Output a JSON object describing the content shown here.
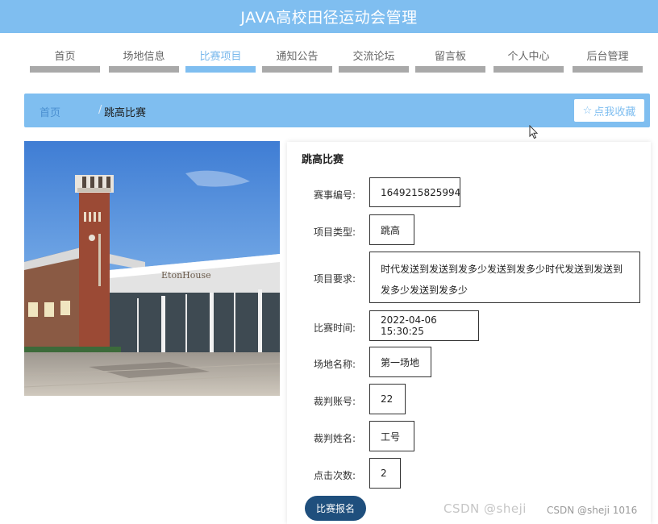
{
  "app": {
    "title": "JAVA高校田径运动会管理"
  },
  "nav": {
    "items": [
      {
        "label": "首页"
      },
      {
        "label": "场地信息"
      },
      {
        "label": "比赛项目"
      },
      {
        "label": "通知公告"
      },
      {
        "label": "交流论坛"
      },
      {
        "label": "留言板"
      },
      {
        "label": "个人中心"
      },
      {
        "label": "后台管理"
      }
    ],
    "active_index": 2
  },
  "breadcrumb": {
    "home": "首页",
    "separator": "/",
    "current": "跳高比赛"
  },
  "favorite_button": {
    "icon": "star-outline-icon",
    "label": "点我收藏"
  },
  "detail": {
    "title": "跳高比赛",
    "fields": [
      {
        "label": "赛事编号:",
        "value": "1649215825994"
      },
      {
        "label": "项目类型:",
        "value": "跳高"
      },
      {
        "label": "项目要求:",
        "value": "时代发送到发送到发多少发送到发多少时代发送到发送到发多少发送到发多少"
      },
      {
        "label": "比赛时间:",
        "value": "2022-04-06 15:30:25"
      },
      {
        "label": "场地名称:",
        "value": "第一场地"
      },
      {
        "label": "裁判账号:",
        "value": "22"
      },
      {
        "label": "裁判姓名:",
        "value": "工号"
      },
      {
        "label": "点击次数:",
        "value": "2"
      }
    ],
    "signup_button": "比赛报名"
  },
  "watermark": {
    "faded": "CSDN @sheji",
    "text": "CSDN @sheji 1016"
  },
  "colors": {
    "accent": "#7fbef0",
    "nav_bar": "#a9a9a9",
    "button_dark": "#1f4f7d"
  }
}
